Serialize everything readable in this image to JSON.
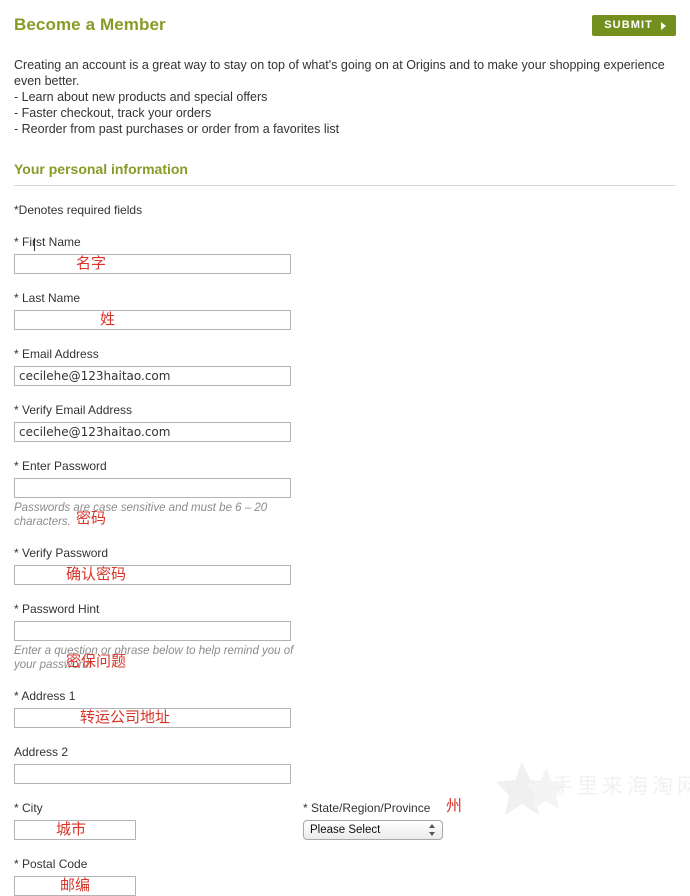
{
  "header": {
    "title": "Become a Member",
    "submit_label": "SUBMIT",
    "submit_arrow_icon": "triangle-right-icon"
  },
  "intro": {
    "paragraph": "Creating an account is a great way to stay on top of what's going on at Origins and to make your shopping experience even better.",
    "bullets": [
      "- Learn about new products and special offers",
      "- Faster checkout, track your orders",
      "- Reorder from past purchases or order from a favorites list"
    ]
  },
  "section": {
    "title": "Your personal information",
    "denotes": "*Denotes required fields"
  },
  "fields": {
    "first_name": {
      "label": "* First Name",
      "value": "",
      "annotation": "名字"
    },
    "last_name": {
      "label": "* Last Name",
      "value": "",
      "annotation": "姓"
    },
    "email": {
      "label": "* Email Address",
      "value": "cecilehe@123haitao.com"
    },
    "verify_email": {
      "label": "* Verify Email Address",
      "value": "cecilehe@123haitao.com"
    },
    "password": {
      "label": "* Enter Password",
      "value": "",
      "annotation": "密码",
      "hint": "Passwords are case sensitive and must be 6 – 20 characters."
    },
    "verify_password": {
      "label": "* Verify Password",
      "value": "",
      "annotation": "确认密码"
    },
    "password_hint": {
      "label": "* Password Hint",
      "value": "",
      "annotation": "密保问题",
      "hint": "Enter a question or phrase below to help remind you of your password."
    },
    "address1": {
      "label": "* Address 1",
      "value": "",
      "annotation": "转运公司地址"
    },
    "address2": {
      "label": "Address 2",
      "value": ""
    },
    "city": {
      "label": "* City",
      "value": "",
      "annotation": "城市"
    },
    "state": {
      "label": "* State/Region/Province",
      "annotation": "州",
      "selected": "Please Select",
      "options": [
        "Please Select"
      ]
    },
    "postal_code": {
      "label": "* Postal Code",
      "value": "",
      "annotation": "邮编"
    }
  },
  "watermark": {
    "text": "手里来海淘网",
    "star_icon": "star-icon"
  },
  "colors": {
    "heading_green": "#8a9a27",
    "button_green": "#73901e",
    "annotation_red": "#d8342a",
    "hint_gray": "#8c8c8c",
    "input_border": "#b3b3b3"
  }
}
